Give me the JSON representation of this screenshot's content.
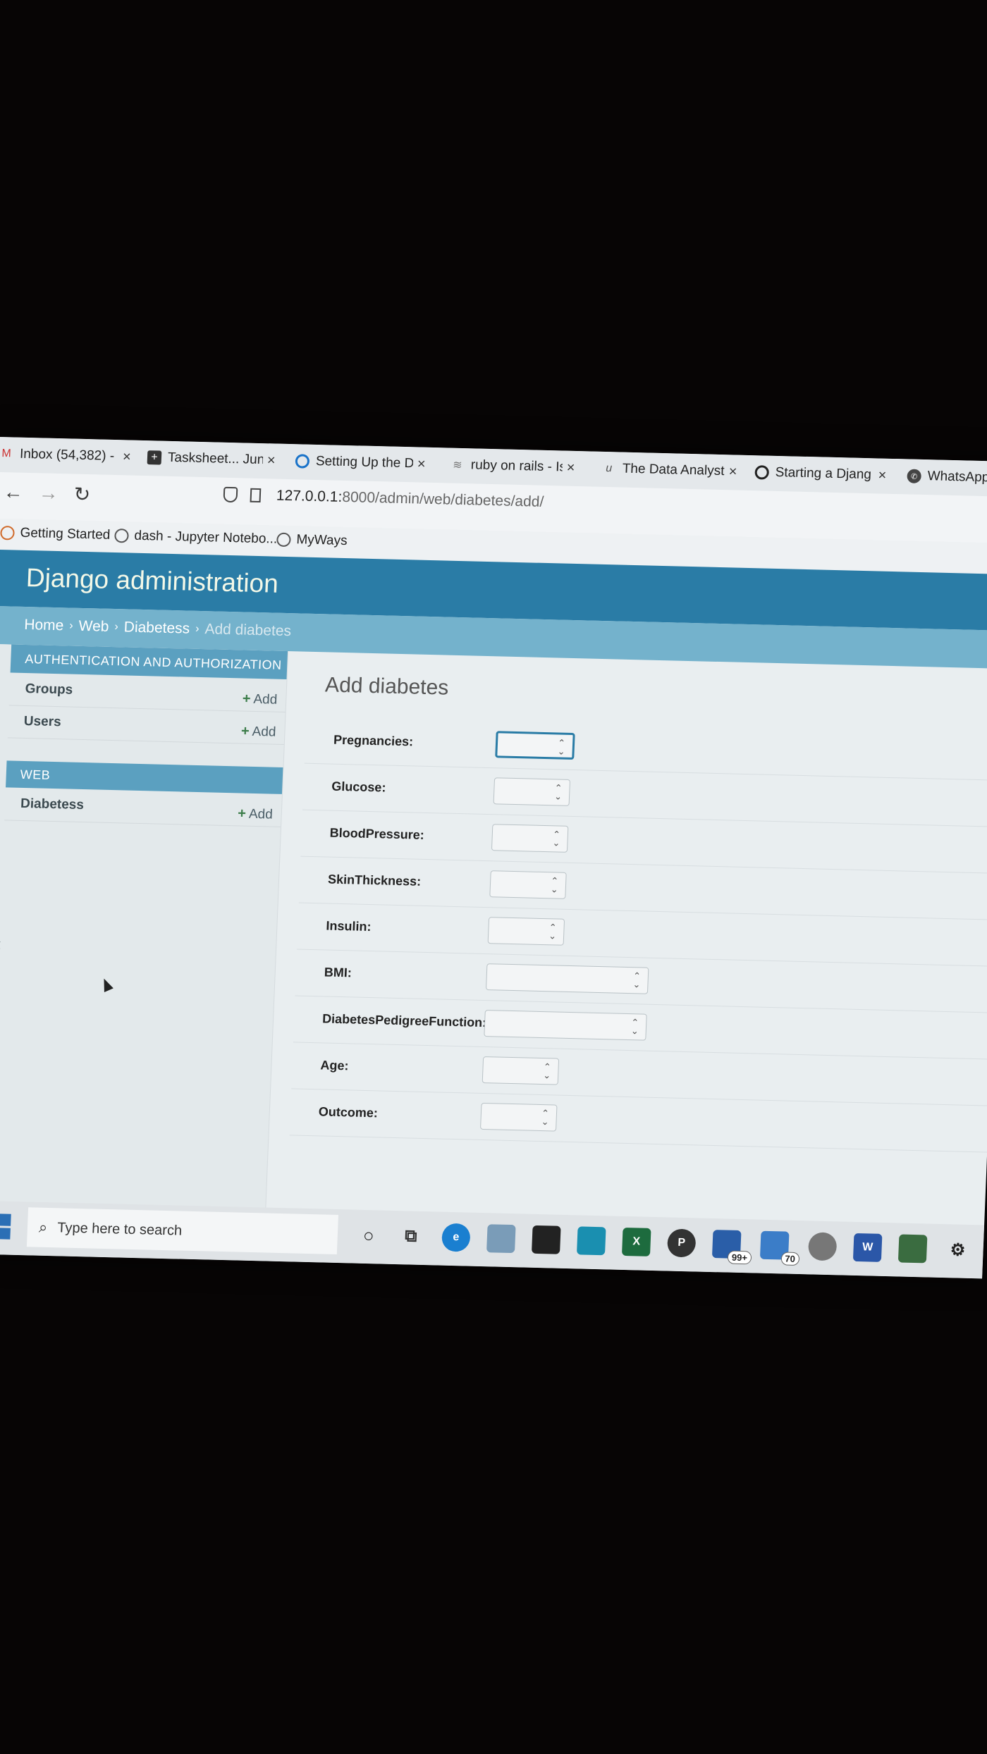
{
  "browser": {
    "tabs": [
      {
        "title": "Inbox (54,382) - ",
        "icon": "gmail-icon"
      },
      {
        "title": "Tasksheet... June",
        "icon": "sheet-icon"
      },
      {
        "title": "Setting Up the D",
        "icon": "digitalocean-icon"
      },
      {
        "title": "ruby on rails - Is",
        "icon": "stackoverflow-icon"
      },
      {
        "title": "The Data Analyst",
        "icon": "udemy-icon"
      },
      {
        "title": "Starting a Djang",
        "icon": "github-icon"
      },
      {
        "title": "WhatsApp",
        "icon": "whatsapp-icon"
      }
    ],
    "close_glyph": "×",
    "url_host": "127.0.0.1:",
    "url_path": "8000/admin/web/diabetes/add/",
    "bookmarks": [
      {
        "label": "Getting Started",
        "icon": "firefox-icon"
      },
      {
        "label": "dash - Jupyter Notebo...",
        "icon": "globe-icon"
      },
      {
        "label": "MyWays",
        "icon": "globe-icon"
      }
    ]
  },
  "admin": {
    "site_title": "Django administration",
    "breadcrumbs": [
      "Home",
      "Web",
      "Diabetess",
      "Add diabetes"
    ],
    "sidebar": {
      "modules": [
        {
          "caption": "AUTHENTICATION AND AUTHORIZATION",
          "models": [
            {
              "name": "Groups",
              "add": "Add"
            },
            {
              "name": "Users",
              "add": "Add"
            }
          ]
        },
        {
          "caption": "WEB",
          "models": [
            {
              "name": "Diabetess",
              "add": "Add"
            }
          ]
        }
      ],
      "collapse_glyph": "«"
    },
    "page_title": "Add diabetes",
    "fields": [
      {
        "label": "Pregnancies:",
        "value": ""
      },
      {
        "label": "Glucose:",
        "value": ""
      },
      {
        "label": "BloodPressure:",
        "value": ""
      },
      {
        "label": "SkinThickness:",
        "value": ""
      },
      {
        "label": "Insulin:",
        "value": ""
      },
      {
        "label": "BMI:",
        "value": ""
      },
      {
        "label": "DiabetesPedigreeFunction:",
        "value": ""
      },
      {
        "label": "Age:",
        "value": ""
      },
      {
        "label": "Outcome:",
        "value": ""
      }
    ]
  },
  "taskbar": {
    "search_placeholder": "Type here to search",
    "badges": {
      "mail": "99+",
      "files": "70"
    },
    "colors": {
      "accent": "#2a7ca6",
      "breadcrumb": "#74b2cc",
      "module": "#5ba0c0"
    }
  }
}
